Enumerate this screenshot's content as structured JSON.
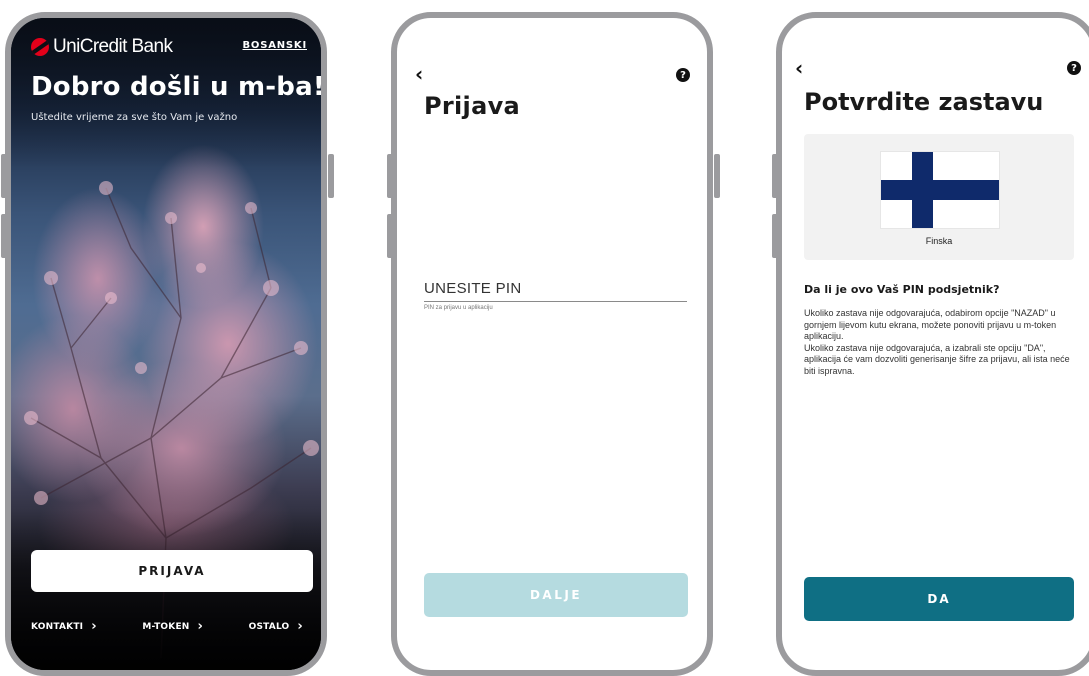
{
  "screen1": {
    "brand": "UniCredit Bank",
    "language": "BOSANSKI",
    "title": "Dobro došli u m-ba!",
    "subtitle": "Uštedite vrijeme za sve što Vam je važno",
    "login_button": "PRIJAVA",
    "links": [
      {
        "label": "KONTAKTI",
        "icon": "chevron-right-icon"
      },
      {
        "label": "M-TOKEN",
        "icon": "chevron-right-icon"
      },
      {
        "label": "OSTALO",
        "icon": "chevron-right-icon"
      }
    ]
  },
  "screen2": {
    "back_icon": "back-chevron-icon",
    "help_icon": "help-icon",
    "title": "Prijava",
    "pin_placeholder": "UNESITE PIN",
    "pin_hint": "PIN za prijavu u aplikaciju",
    "next_button": "DALJE",
    "next_button_color": "#b5dbe0"
  },
  "screen3": {
    "back_icon": "back-chevron-icon",
    "help_icon": "help-icon",
    "title": "Potvrdite zastavu",
    "flag_name": "Finska",
    "question": "Da li je ovo Vaš PIN podsjetnik?",
    "body_1": "Ukoliko zastava nije odgovarajuća, odabirom opcije \"NAZAD\" u gornjem lijevom kutu ekrana, možete ponoviti prijavu u m-token aplikaciju.",
    "body_2": "Ukoliko zastava nije odgovarajuća, a izabrali ste opciju \"DA\", aplikacija će vam dozvoliti generisanje šifre za prijavu, ali ista neće biti ispravna.",
    "confirm_button": "DA",
    "confirm_button_color": "#0f6f84",
    "flag_color": "#0f2a6b"
  }
}
